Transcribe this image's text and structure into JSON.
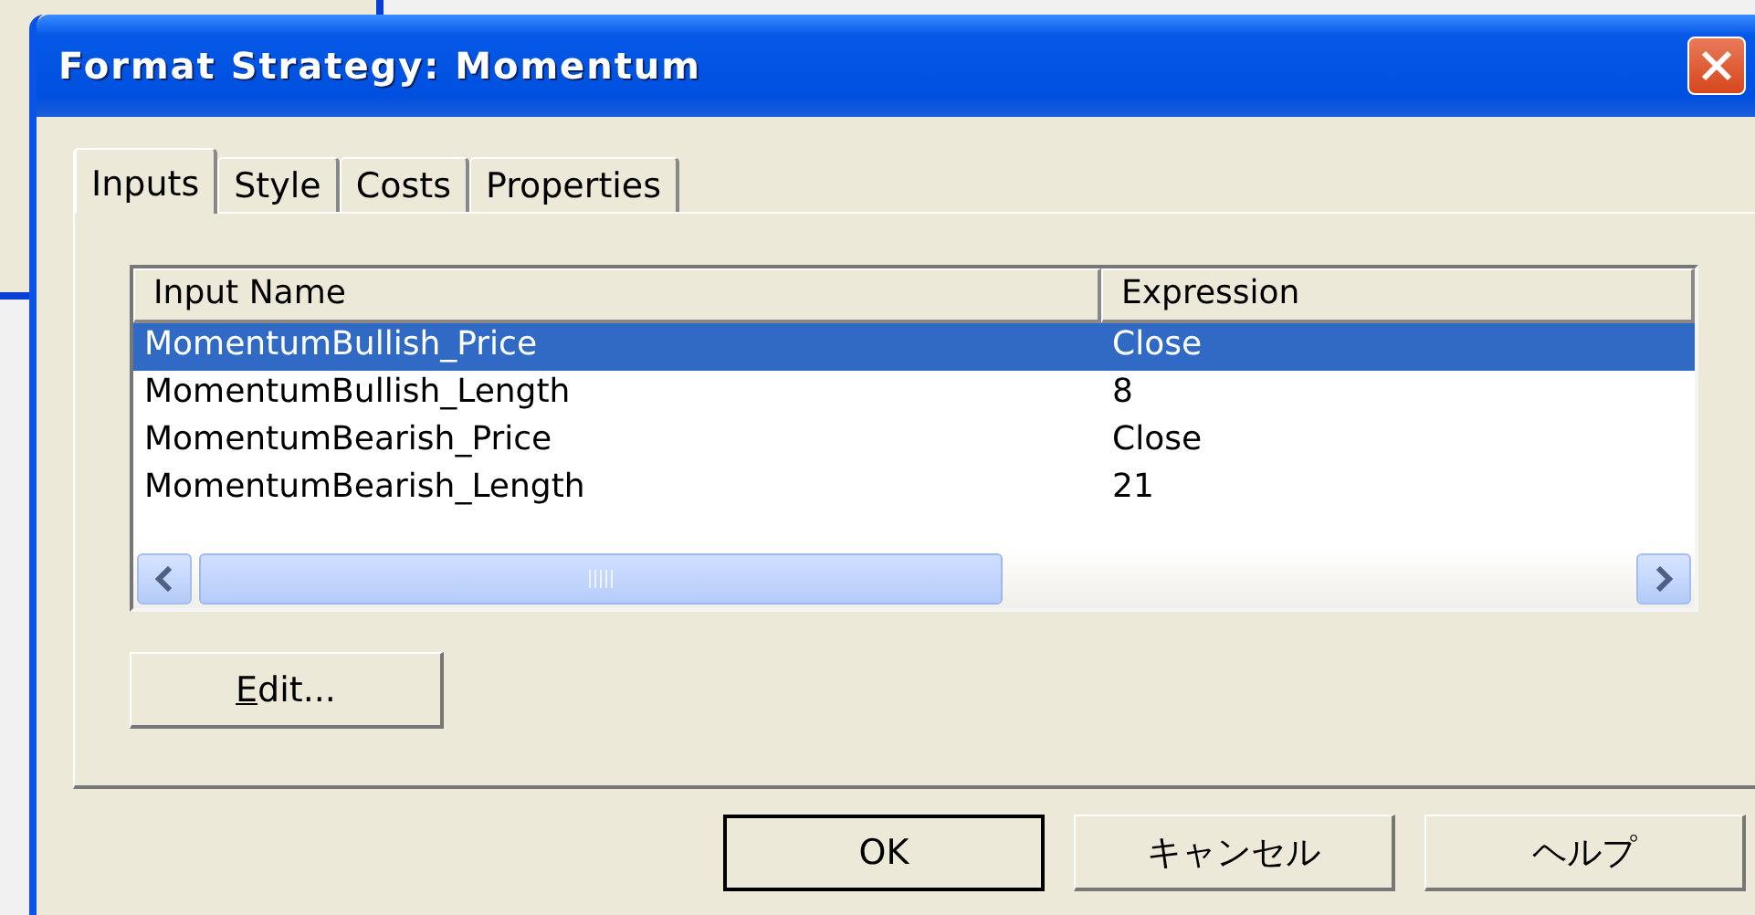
{
  "window": {
    "title": "Format Strategy: Momentum"
  },
  "tabs": [
    {
      "label": "Inputs",
      "selected": true
    },
    {
      "label": "Style",
      "selected": false
    },
    {
      "label": "Costs",
      "selected": false
    },
    {
      "label": "Properties",
      "selected": false
    }
  ],
  "table": {
    "columns": [
      "Input Name",
      "Expression"
    ],
    "rows": [
      {
        "cells": [
          "MomentumBullish_Price",
          "Close"
        ],
        "selected": true
      },
      {
        "cells": [
          "MomentumBullish_Length",
          "8"
        ],
        "selected": false
      },
      {
        "cells": [
          "MomentumBearish_Price",
          "Close"
        ],
        "selected": false
      },
      {
        "cells": [
          "MomentumBearish_Length",
          "21"
        ],
        "selected": false
      }
    ]
  },
  "edit_button": "Edit...",
  "buttons": [
    {
      "label": "OK",
      "default": true
    },
    {
      "label": "キャンセル",
      "default": false
    },
    {
      "label": "ヘルプ",
      "default": false
    }
  ]
}
